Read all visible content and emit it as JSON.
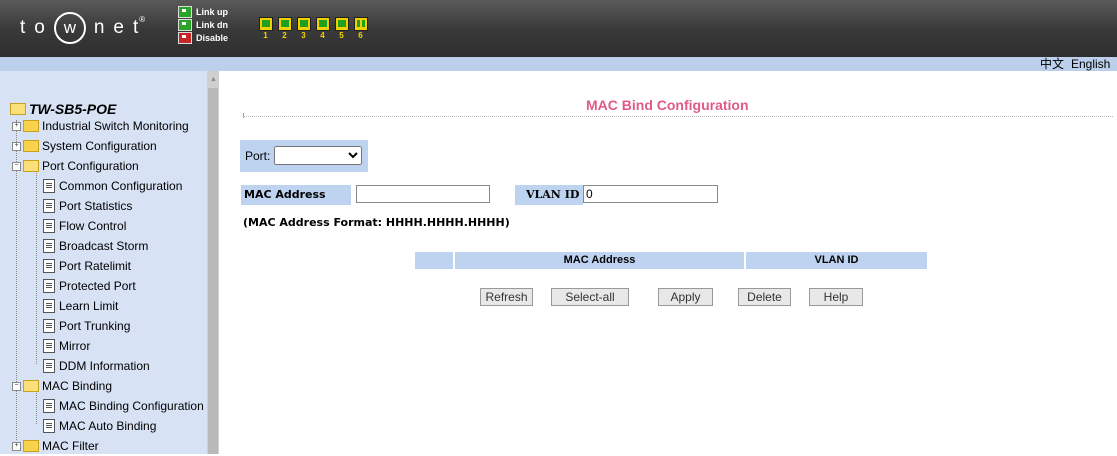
{
  "header": {
    "logo_text": "to",
    "logo_circle": "w",
    "logo_tail": "net",
    "logo_tm": "®",
    "legend": [
      {
        "label": "Link up",
        "color": "#2aa52a"
      },
      {
        "label": "Link dn",
        "color": "#2aa52a"
      },
      {
        "label": "Disable",
        "color": "#c62828"
      }
    ],
    "ports": [
      "1",
      "2",
      "3",
      "4",
      "5",
      "6"
    ]
  },
  "langbar": {
    "chinese": "中文",
    "english": "English"
  },
  "sidebar": {
    "title": "TW-SB5-POE",
    "items": [
      {
        "label": "Industrial Switch Monitoring",
        "type": "folder",
        "expanded": false
      },
      {
        "label": "System Configuration",
        "type": "folder",
        "expanded": false
      },
      {
        "label": "Port Configuration",
        "type": "folder",
        "expanded": true
      },
      {
        "label": "Common Configuration",
        "type": "page"
      },
      {
        "label": "Port Statistics",
        "type": "page"
      },
      {
        "label": "Flow Control",
        "type": "page"
      },
      {
        "label": "Broadcast Storm",
        "type": "page"
      },
      {
        "label": "Port Ratelimit",
        "type": "page"
      },
      {
        "label": "Protected Port",
        "type": "page"
      },
      {
        "label": "Learn Limit",
        "type": "page"
      },
      {
        "label": "Port Trunking",
        "type": "page"
      },
      {
        "label": "Mirror",
        "type": "page"
      },
      {
        "label": "DDM Information",
        "type": "page"
      },
      {
        "label": "MAC Binding",
        "type": "folder",
        "expanded": true
      },
      {
        "label": "MAC Binding Configuration",
        "type": "page"
      },
      {
        "label": "MAC Auto Binding",
        "type": "page"
      },
      {
        "label": "MAC Filter",
        "type": "folder",
        "expanded": false
      }
    ]
  },
  "main": {
    "title": "MAC Bind Configuration",
    "port_label": "Port:",
    "port_value": "",
    "mac_label": "MAC Address",
    "mac_value": "",
    "vlan_label": "VLAN ID",
    "vlan_value": "0",
    "format_note": "(MAC Address Format: HHHH.HHHH.HHHH)",
    "table_headers": [
      "",
      "MAC Address",
      "VLAN ID"
    ],
    "buttons": [
      "Refresh",
      "Select-all",
      "Apply",
      "Delete",
      "Help"
    ]
  },
  "colors": {
    "accent_title": "#e05a8a",
    "panel_blue": "#bed3f0",
    "sidebar_bg": "#d7e2f5"
  }
}
